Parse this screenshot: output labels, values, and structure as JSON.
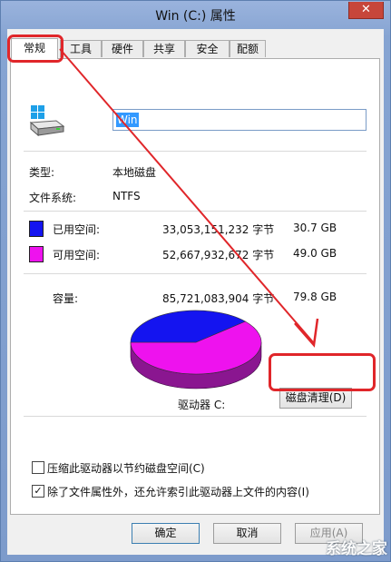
{
  "window": {
    "title": "Win (C:) 属性",
    "close_label": "✕"
  },
  "tabs": [
    {
      "label": "常规",
      "active": true
    },
    {
      "label": "工具"
    },
    {
      "label": "硬件"
    },
    {
      "label": "共享"
    },
    {
      "label": "安全"
    },
    {
      "label": "配额"
    }
  ],
  "drive": {
    "name_value": "Win",
    "icon": "drive-icon"
  },
  "info": {
    "type_label": "类型:",
    "type_value": "本地磁盘",
    "fs_label": "文件系统:",
    "fs_value": "NTFS"
  },
  "space": {
    "used_label": "已用空间:",
    "used_bytes": "33,053,151,232 字节",
    "used_size": "30.7 GB",
    "free_label": "可用空间:",
    "free_bytes": "52,667,932,672 字节",
    "free_size": "49.0 GB",
    "capacity_label": "容量:",
    "capacity_bytes": "85,721,083,904 字节",
    "capacity_size": "79.8 GB"
  },
  "pie": {
    "used_fraction": 0.386,
    "used_color": "#1414f0",
    "free_color": "#ee12ee",
    "drive_label": "驱动器 C:"
  },
  "buttons": {
    "cleanup": "磁盘清理(D)",
    "ok": "确定",
    "cancel": "取消",
    "apply": "应用(A)"
  },
  "options": {
    "compress_label": "压缩此驱动器以节约磁盘空间(C)",
    "compress_checked": false,
    "index_label": "除了文件属性外，还允许索引此驱动器上文件的内容(I)",
    "index_checked": true
  },
  "watermark": "系统之家",
  "colors": {
    "annotation": "#e0262a",
    "used": "#1414f0",
    "free": "#ee12ee",
    "accent": "#3399ff"
  }
}
